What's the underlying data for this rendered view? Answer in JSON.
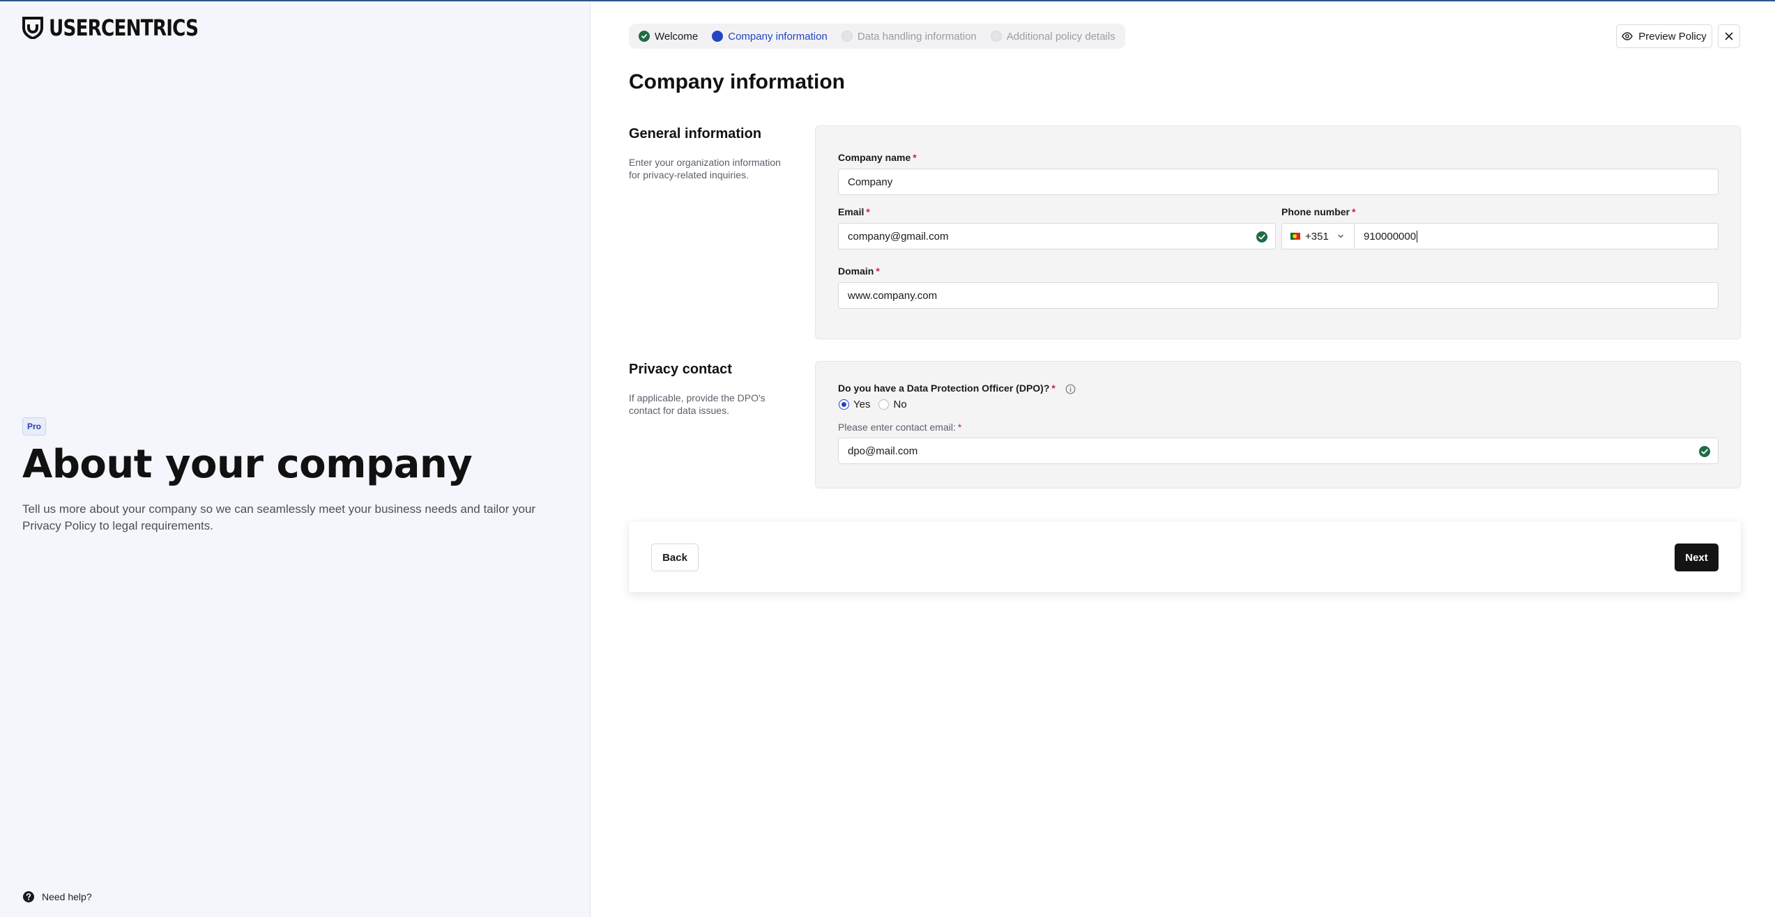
{
  "brand": {
    "logo_text": "USERCENTRICS",
    "plan_badge": "Pro",
    "heading": "About your company",
    "description": "Tell us more about your company so we can seamlessly meet your business needs and tailor your Privacy Policy to legal requirements.",
    "help_link": "Need help?"
  },
  "stepper": {
    "steps": [
      {
        "label": "Welcome",
        "state": "done"
      },
      {
        "label": "Company information",
        "state": "active"
      },
      {
        "label": "Data handling information",
        "state": "todo"
      },
      {
        "label": "Additional policy details",
        "state": "todo"
      }
    ]
  },
  "header": {
    "preview_label": "Preview Policy",
    "close_icon": "close-icon"
  },
  "page_title": "Company information",
  "general": {
    "title": "General information",
    "description": "Enter your organization information for privacy-related inquiries.",
    "company_name_label": "Company name",
    "company_name_value": "Company",
    "email_label": "Email",
    "email_value": "company@gmail.com",
    "phone_label": "Phone number",
    "phone_country_code": "+351",
    "phone_value": "910000000",
    "domain_label": "Domain",
    "domain_value": "www.company.com"
  },
  "privacy": {
    "title": "Privacy contact",
    "description": "If applicable, provide the DPO's contact for data issues.",
    "dpo_question": "Do you have a Data Protection Officer (DPO)?",
    "yes_label": "Yes",
    "no_label": "No",
    "selected": "Yes",
    "contact_email_label": "Please enter contact email:",
    "contact_email_value": "dpo@mail.com"
  },
  "footer": {
    "back_label": "Back",
    "next_label": "Next"
  },
  "colors": {
    "accent": "#2443c4",
    "success": "#1e6b45",
    "required": "#d0213a",
    "primary_button": "#141414"
  }
}
